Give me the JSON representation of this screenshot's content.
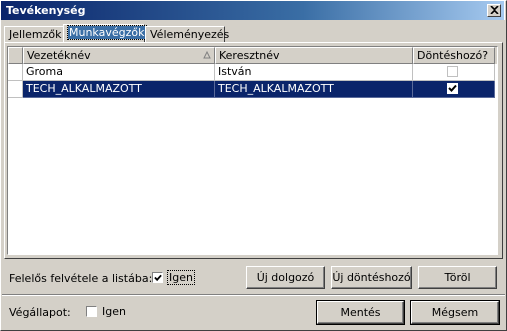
{
  "window": {
    "title": "Tevékenység"
  },
  "tabs": [
    {
      "label": "Jellemzők"
    },
    {
      "label": "Munkavégzők"
    },
    {
      "label": "Véleményezés"
    }
  ],
  "grid": {
    "columns": [
      "Vezetéknév",
      "Keresztnév",
      "Döntéshozó?"
    ],
    "rows": [
      {
        "last": "Groma",
        "first": "István",
        "decision_maker": false
      },
      {
        "last": "TECH_ALKALMAZOTT",
        "first": "TECH_ALKALMAZOTT",
        "decision_maker": true
      }
    ]
  },
  "responsible": {
    "label": "Felelős felvétele a listába:",
    "checkbox_label": "Igen",
    "checked": true
  },
  "buttons": {
    "new_worker": "Új dolgozó",
    "new_decision_maker": "Új döntéshozó",
    "delete": "Töröl",
    "save": "Mentés",
    "cancel": "Mégsem"
  },
  "final_state": {
    "label": "Végállapot:",
    "checkbox_label": "Igen",
    "checked": false
  },
  "icons": {
    "close": "close-icon",
    "sort": "sort-ascending-icon",
    "check": "checkmark-icon"
  },
  "colors": {
    "title_start": "#0a246a",
    "title_end": "#a6caf0",
    "selection": "#0a246a",
    "face": "#d4d0c8"
  }
}
